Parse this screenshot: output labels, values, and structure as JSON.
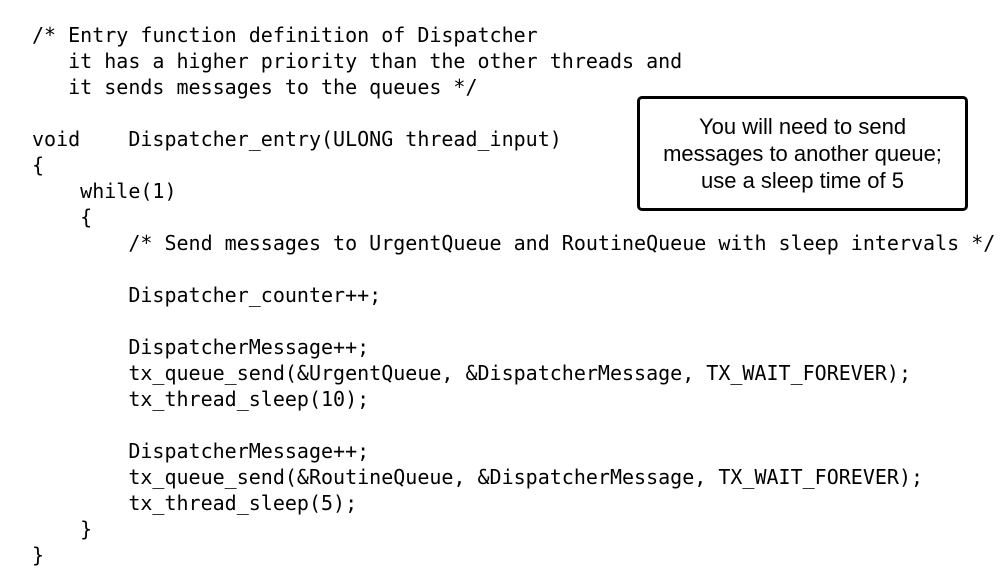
{
  "code_lines": [
    "/* Entry function definition of Dispatcher",
    "   it has a higher priority than the other threads and",
    "   it sends messages to the queues */",
    "",
    "void    Dispatcher_entry(ULONG thread_input)",
    "{",
    "    while(1)",
    "    {",
    "        /* Send messages to UrgentQueue and RoutineQueue with sleep intervals */",
    "",
    "        Dispatcher_counter++;",
    "",
    "        DispatcherMessage++;",
    "        tx_queue_send(&UrgentQueue, &DispatcherMessage, TX_WAIT_FOREVER);",
    "        tx_thread_sleep(10);",
    "",
    "        DispatcherMessage++;",
    "        tx_queue_send(&RoutineQueue, &DispatcherMessage, TX_WAIT_FOREVER);",
    "        tx_thread_sleep(5);",
    "    }",
    "}"
  ],
  "callout": {
    "lines": [
      "You will need to send",
      "messages to another queue;",
      "use a sleep time of 5"
    ]
  }
}
